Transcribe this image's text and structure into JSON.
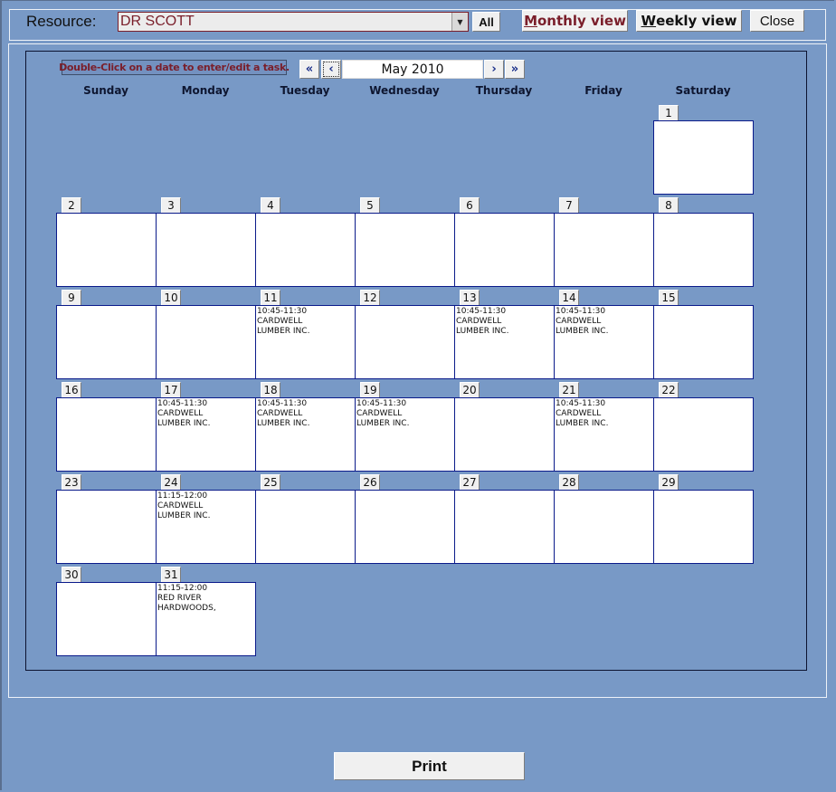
{
  "toolbar": {
    "resource_label": "Resource:",
    "resource_value": "DR SCOTT",
    "all_label": "All",
    "monthly_view_label_accel": "M",
    "monthly_view_label_rest": "onthly view",
    "weekly_view_label_accel": "W",
    "weekly_view_label_rest": "eekly view",
    "close_label": "Close"
  },
  "calendar": {
    "hint": "Double-Click on a date to enter/edit a task.",
    "month_label": "May 2010",
    "nav": {
      "first": "«",
      "prev": "‹",
      "next": "›",
      "last": "»"
    },
    "weekdays": [
      "Sunday",
      "Monday",
      "Tuesday",
      "Wednesday",
      "Thursday",
      "Friday",
      "Saturday"
    ],
    "first_weekday_index": 6,
    "days": [
      {
        "day": "1",
        "task": ""
      },
      {
        "day": "2",
        "task": ""
      },
      {
        "day": "3",
        "task": ""
      },
      {
        "day": "4",
        "task": ""
      },
      {
        "day": "5",
        "task": ""
      },
      {
        "day": "6",
        "task": ""
      },
      {
        "day": "7",
        "task": ""
      },
      {
        "day": "8",
        "task": ""
      },
      {
        "day": "9",
        "task": ""
      },
      {
        "day": "10",
        "task": ""
      },
      {
        "day": "11",
        "task": "10:45-11:30\nCARDWELL\nLUMBER INC."
      },
      {
        "day": "12",
        "task": ""
      },
      {
        "day": "13",
        "task": "10:45-11:30\nCARDWELL\nLUMBER INC."
      },
      {
        "day": "14",
        "task": "10:45-11:30\nCARDWELL\nLUMBER INC."
      },
      {
        "day": "15",
        "task": ""
      },
      {
        "day": "16",
        "task": ""
      },
      {
        "day": "17",
        "task": "10:45-11:30\nCARDWELL\nLUMBER INC."
      },
      {
        "day": "18",
        "task": "10:45-11:30\nCARDWELL\nLUMBER INC."
      },
      {
        "day": "19",
        "task": "10:45-11:30\nCARDWELL\nLUMBER INC."
      },
      {
        "day": "20",
        "task": ""
      },
      {
        "day": "21",
        "task": "10:45-11:30\nCARDWELL\nLUMBER INC."
      },
      {
        "day": "22",
        "task": ""
      },
      {
        "day": "23",
        "task": ""
      },
      {
        "day": "24",
        "task": "11:15-12:00\nCARDWELL\nLUMBER INC."
      },
      {
        "day": "25",
        "task": ""
      },
      {
        "day": "26",
        "task": ""
      },
      {
        "day": "27",
        "task": ""
      },
      {
        "day": "28",
        "task": ""
      },
      {
        "day": "29",
        "task": ""
      },
      {
        "day": "30",
        "task": ""
      },
      {
        "day": "31",
        "task": "11:15-12:00\nRED RIVER\nHARDWOODS,"
      }
    ]
  },
  "footer": {
    "print_label": "Print"
  },
  "colors": {
    "background": "#7899c6",
    "accent_text": "#7a1e2a",
    "cell_border": "#0a1a8a"
  }
}
